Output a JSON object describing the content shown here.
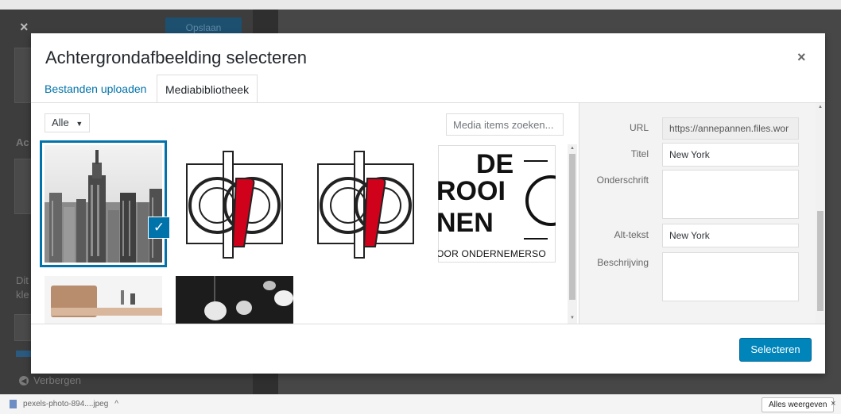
{
  "backdrop": {
    "close_glyph": "×",
    "save_button": "Opslaan",
    "panel_initial": "Ac",
    "panel_text_1": "Dit",
    "panel_text_2": "kle",
    "hide_label": "Verbergen"
  },
  "modal": {
    "title": "Achtergrondafbeelding selecteren",
    "close_glyph": "×",
    "tabs": [
      {
        "label": "Bestanden uploaden"
      },
      {
        "label": "Mediabibliotheek"
      }
    ]
  },
  "browser": {
    "filter": {
      "selected": "Alle",
      "arrow": "▼"
    },
    "search": {
      "placeholder": "Media items zoeken..."
    },
    "attachments": [
      {
        "name": "new-york-skyline",
        "selected": true
      },
      {
        "name": "logo-dp-1",
        "selected": false
      },
      {
        "name": "logo-dp-2",
        "selected": false
      },
      {
        "name": "de-rooi-pannen-logo",
        "selected": false,
        "text_lines": [
          "DE",
          "ROOI",
          "NEN",
          "OOR ONDERNEMERSO"
        ]
      },
      {
        "name": "interior-photo",
        "selected": false
      },
      {
        "name": "dark-lamps-photo",
        "selected": false
      }
    ],
    "check_glyph": "✓"
  },
  "details": {
    "url": {
      "label": "URL",
      "value": "https://annepannen.files.wor"
    },
    "title": {
      "label": "Titel",
      "value": "New York"
    },
    "caption": {
      "label": "Onderschrift",
      "value": ""
    },
    "alt": {
      "label": "Alt-tekst",
      "value": "New York"
    },
    "description": {
      "label": "Beschrijving",
      "value": ""
    }
  },
  "toolbar": {
    "select_label": "Selecteren"
  },
  "download_bar": {
    "file_name": "pexels-photo-894....jpeg",
    "chevron": "^",
    "show_all": "Alles weergeven",
    "close_glyph": "×"
  },
  "colors": {
    "accent": "#0073aa",
    "button": "#0085ba",
    "logo_red": "#d0021b"
  }
}
